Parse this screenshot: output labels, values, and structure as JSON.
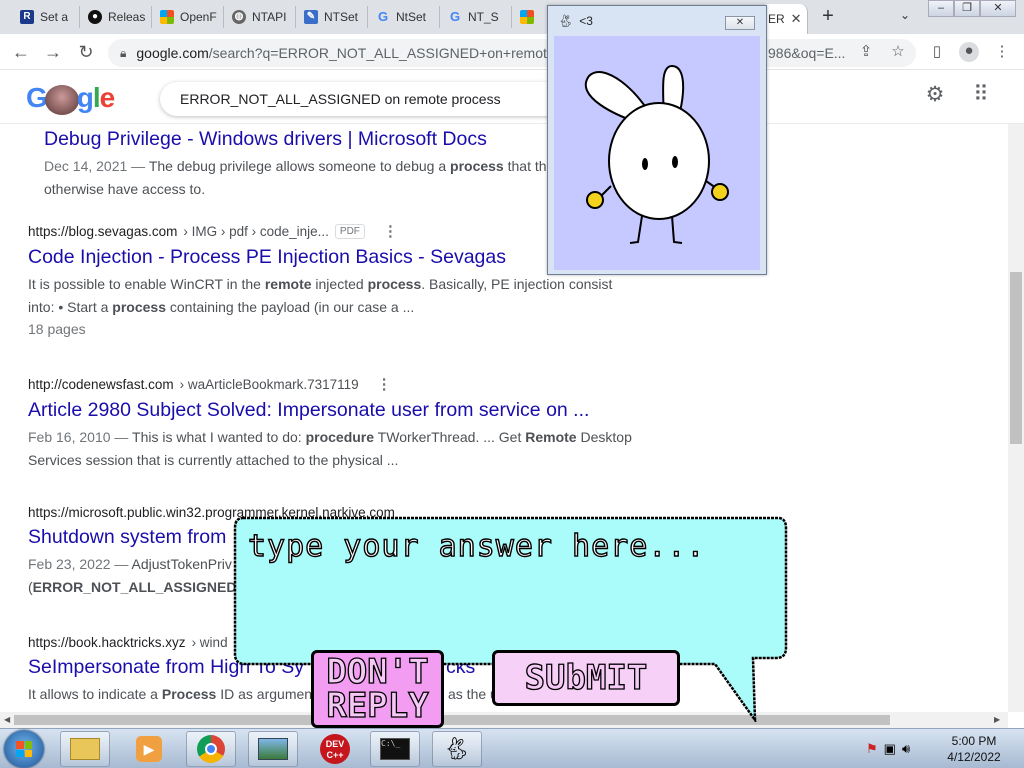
{
  "browser": {
    "tabs": [
      {
        "label": "Set a",
        "icon": "app-icon"
      },
      {
        "label": "Releas",
        "icon": "github-icon"
      },
      {
        "label": "OpenF",
        "icon": "microsoft-icon"
      },
      {
        "label": "NTAPI",
        "icon": "globe-icon"
      },
      {
        "label": "NTSet",
        "icon": "ntset-icon"
      },
      {
        "label": "NtSet",
        "icon": "google-icon"
      },
      {
        "label": "NT_S",
        "icon": "google-icon"
      },
      {
        "label": "",
        "icon": "microsoft-icon"
      },
      {
        "label": "ER",
        "icon": "google-icon"
      }
    ],
    "new_tab_label": "+",
    "address": {
      "domain": "google.com",
      "path": "/search?q=ERROR_NOT_ALL_ASSIGNED+on+remote+",
      "tail": "986&oq=E..."
    }
  },
  "google": {
    "logo_text": "Google",
    "query": "ERROR_NOT_ALL_ASSIGNED on remote process"
  },
  "results": [
    {
      "cite": "",
      "crumb": "",
      "title": "Debug Privilege - Windows drivers | Microsoft Docs",
      "date": "Dec 14, 2021 —",
      "snippet_html": "The debug privilege allows someone to debug a <b>process</b> that the",
      "snippet2_html": "otherwise have access to."
    },
    {
      "cite": "https://blog.sevagas.com",
      "crumb": "› IMG › pdf › code_inje...",
      "pdf": "PDF",
      "title": "Code Injection - Process PE Injection Basics - Sevagas",
      "snippet_html": "It is possible to enable WinCRT in the <b>remote</b> injected <b>process</b>. Basically, PE injection consist",
      "snippet2_html": "into: • Start a <b>process</b> containing the payload (in our case a ...",
      "pages": "18 pages"
    },
    {
      "cite": "http://codenewsfast.com",
      "crumb": "› waArticleBookmark.7317119",
      "title": "Article 2980 Subject Solved: Impersonate user from service on ...",
      "date": "Feb 16, 2010 —",
      "snippet_html": "This is what I wanted to do: <b>procedure</b> TWorkerThread. ... Get <b>Remote</b> Desktop",
      "snippet2_html": "Services session that is currently attached to the physical ..."
    },
    {
      "cite": "https://microsoft.public.win32.programmer.kernel.narkive.com",
      "crumb": "",
      "title": "Shutdown system from",
      "date": "Feb 23, 2022 —",
      "snippet_html": "AdjustTokenPriv",
      "snippet2_html": "(<b>ERROR_NOT_ALL_ASSIGNED</b>). I"
    },
    {
      "cite": "https://book.hacktricks.xyz",
      "crumb": "› wind",
      "title": "SeImpersonate from High To Sy",
      "title_tail": "cks",
      "snippet_html": "It allows to indicate a <b>Process</b> ID as argumen",
      "snippet_tail": "as the u"
    }
  ],
  "bunny_window": {
    "title": "<3",
    "close_label": "✕"
  },
  "dialog": {
    "answer_placeholder": "type your answer here...",
    "dont_reply_line1": "DON'T",
    "dont_reply_line2": "REPLY",
    "submit_label": "SUbMIT"
  },
  "taskbar": {
    "time": "5:00 PM",
    "date": "4/12/2022"
  },
  "colors": {
    "bubble_fill": "#aafcfa",
    "bunny_bg": "#c6c9ff",
    "link": "#1a0dab"
  }
}
